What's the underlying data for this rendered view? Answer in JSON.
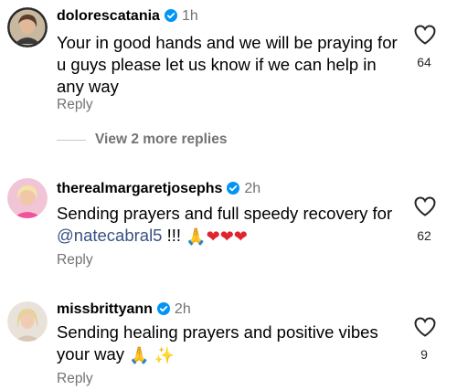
{
  "comments": [
    {
      "username": "dolorescatania",
      "time": "1h",
      "text_plain": "Your in good hands and we will be praying for u guys please let us know if we can help in any way",
      "likes": "64",
      "reply_label": "Reply"
    },
    {
      "username": "therealmargaretjosephs",
      "time": "2h",
      "text_before": "Sending prayers and full speedy recovery for ",
      "mention": "@natecabral5",
      "text_after": " !!! ",
      "emojis": [
        "🙏",
        "❤",
        "❤",
        "❤"
      ],
      "likes": "62",
      "reply_label": "Reply"
    },
    {
      "username": "missbrittyann",
      "time": "2h",
      "text_before": "Sending healing prayers and positive vibes your way ",
      "emojis": [
        "🙏",
        "✨"
      ],
      "likes": "9",
      "reply_label": "Reply"
    }
  ],
  "more_replies_label": "View 2 more replies",
  "icons": {
    "like": "heart-outline-icon",
    "verified": "verified-badge-icon"
  },
  "colors": {
    "verified": "#0095f6",
    "mention": "#385185",
    "secondary_text": "#737373"
  }
}
